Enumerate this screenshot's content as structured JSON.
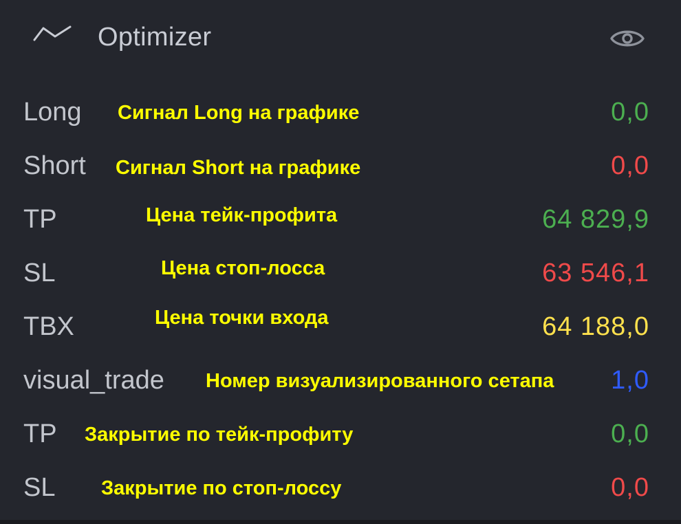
{
  "header": {
    "title": "Optimizer",
    "chart_icon": "line-chart-icon",
    "visibility_icon": "eye-icon"
  },
  "colors": {
    "background": "#24262d",
    "label": "#c3c6cd",
    "note": "#ffff00",
    "green": "#4caf50",
    "red": "#f04a4a",
    "yellow": "#ffe14d",
    "blue": "#2f5bff"
  },
  "rows": [
    {
      "label": "Long",
      "note": "Сигнал Long на графике",
      "value": "0,0",
      "color": "#4caf50"
    },
    {
      "label": "Short",
      "note": "Сигнал Short на графике",
      "value": "0,0",
      "color": "#f04a4a"
    },
    {
      "label": "TP",
      "note": "Цена тейк-профита",
      "value": "64 829,9",
      "color": "#4caf50"
    },
    {
      "label": "SL",
      "note": "Цена стоп-лосса",
      "value": "63 546,1",
      "color": "#f04a4a"
    },
    {
      "label": "TBX",
      "note": "Цена точки входа",
      "value": "64 188,0",
      "color": "#ffe14d"
    },
    {
      "label": "visual_trade",
      "note": "Номер визуализированного сетапа",
      "value": "1,0",
      "color": "#2f5bff"
    },
    {
      "label": "TP",
      "note": "Закрытие по тейк-профиту",
      "value": "0,0",
      "color": "#4caf50"
    },
    {
      "label": "SL",
      "note": "Закрытие по стоп-лоссу",
      "value": "0,0",
      "color": "#f04a4a"
    }
  ]
}
